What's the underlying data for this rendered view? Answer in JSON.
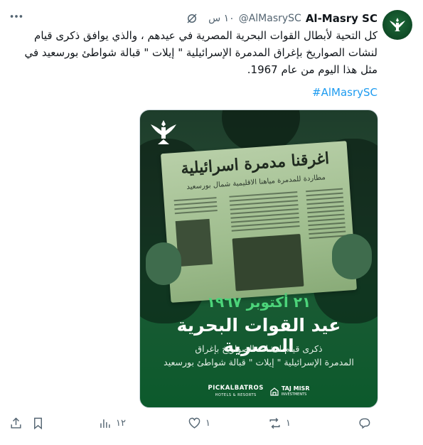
{
  "author": {
    "name": "Al-Masry SC",
    "handle": "@AlMasrySC",
    "time": "١٠ س"
  },
  "post": {
    "text": "كل التحية لأبطال القوات البحرية المصرية في عيدهم ، والذي يوافق ذكرى قيام لنشات الصواريخ بإغراق المدمرة الإسرائيلية \" إيلات \"  قبالة شواطئ بورسعيد في مثل هذا اليوم من عام 1967.",
    "hashtag": "#AlMasrySC"
  },
  "media": {
    "newspaper_headline": "اغرقنا مدمرة اسرائيلية",
    "newspaper_subhead": "مطاردة للمدمرة مياهنا الاقليمية شمال بورسعيد",
    "date": "٢١ أكتوبر ١٩٦٧",
    "title": "عيد القوات البحرية المصرية",
    "subtitle_1": "ذكرى قيام لنشات الصواريخ بإغراق",
    "subtitle_2": "المدمرة الإسرائيلية \" إيلات \" قبالة شواطئ بورسعيد",
    "sponsor_1": "PICKALBATROS",
    "sponsor_1_sub": "HOTELS & RESORTS",
    "sponsor_2": "TAJ MISR",
    "sponsor_2_sub": "INVESTMENTS"
  },
  "actions": {
    "replies": "",
    "reposts": "١",
    "likes": "١",
    "views": "١٢"
  },
  "icons": {
    "more": "more-horizontal-icon",
    "grok": "grok-icon",
    "reply": "reply-icon",
    "repost": "repost-icon",
    "like": "heart-icon",
    "views": "views-chart-icon",
    "bookmark": "bookmark-icon",
    "share": "share-icon"
  },
  "colors": {
    "accent": "#1d9bf0",
    "media_green": "#0c5a2c",
    "date_green": "#4cd47a"
  }
}
